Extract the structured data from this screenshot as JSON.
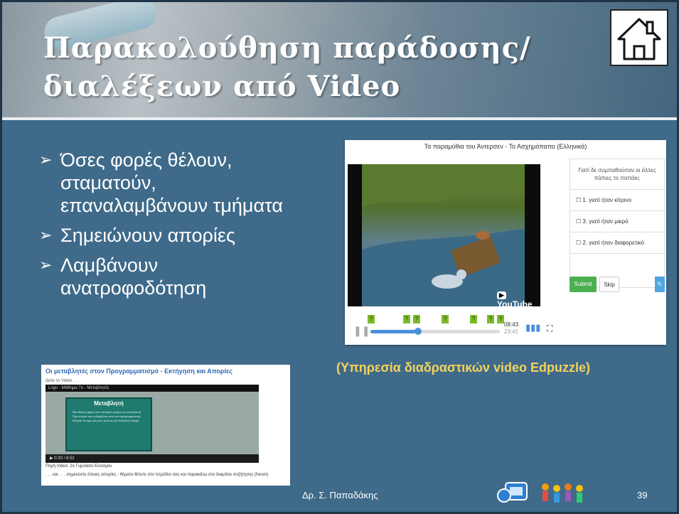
{
  "slide": {
    "title": "Παρακολούθηση παράδοσης/διαλέξεων από Video",
    "bullets": [
      "Όσες φορές θέλουν, σταματούν, επαναλαμβάνουν τμήματα",
      "Σημειώνουν απορίες",
      "Λαμβάνουν ανατροφοδότηση"
    ],
    "bullet_icon": "arrow-icon",
    "caption": "(Υπηρεσία διαδραστικών video Edpuzzle)",
    "author": "Δρ. Σ. Παπαδάκης",
    "page_number": "39"
  },
  "edpuzzle": {
    "video_title": "Τα παραμύθια του Άντερσεν - Το Ασχημόπαπο (Ελληνικά)",
    "youtube_label": "YouTube",
    "question": "Γιατί δε συμπαθούσαν οι άλλες πάπιες το παπάκι;",
    "options": [
      "1. γιατί ήταν κίτρινο",
      "3. γιατί ήταν μικρό",
      "2. γιατί ήταν διαφορετικό"
    ],
    "submit": "Submit",
    "skip": "Skip",
    "reset_icon": "refresh-icon",
    "time_current": "08:43",
    "time_total": "23:41",
    "progress_fraction": 0.37,
    "marker_label": "?",
    "markers_count": 7
  },
  "blog": {
    "title": "Οι μεταβλητές στον Προγραμματισμό - Εκτήγηση και Απορίες",
    "subtitle": "Δείτε το Video . . .",
    "video_bar": "Logo - Μάθημα 7ο - Μεταβλητές",
    "board_heading": "Μεταβλητή",
    "board_lines": [
      "Μια θέση μνήμης στον κεντρικό μνήμη του υπολογιστή",
      "Έχει όνομα που καθορίζεται από τον προγραμματιστή",
      "Μπορεί να έχει μία μόνο τιμή σε μια δεδομένη στιγμή"
    ],
    "video_time": "0:30 / 6:52",
    "source": "Πηγή Video: 2ο Γυμνάσιο Εύοσμου",
    "note": ". . . και . . . σημειώστε όποιες απορίες - θέματα θέλετε στο τετράδιο σας και παρακάτω στο διαμάτιο συζήτησης (forum)"
  },
  "icons": {
    "home": "home-icon",
    "logo_left": "edu-logo-icon",
    "logo_right": "kids-logo-icon"
  },
  "colors": {
    "background": "#3f6a8a",
    "caption": "#f3d35a",
    "submit": "#4caf50",
    "progress": "#4a90d9",
    "marker": "#7cbc2a"
  }
}
